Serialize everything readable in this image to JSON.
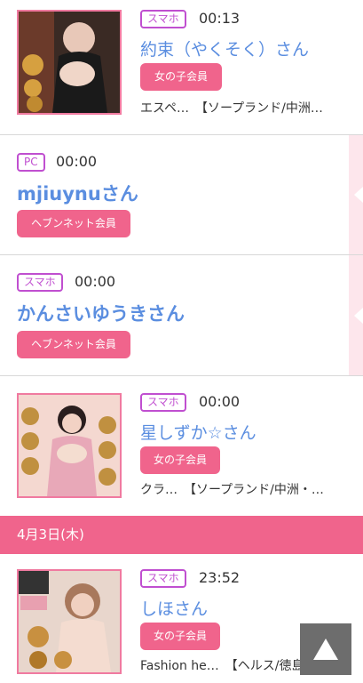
{
  "entries": [
    {
      "device": "スマホ",
      "time": "00:13",
      "name": "約束（やくそく）さん",
      "member_type": "女の子会員",
      "shop": "エスペ…　【ソープランド/中洲…"
    },
    {
      "device": "PC",
      "time": "00:00",
      "name": "mjiuynuさん",
      "member_type": "ヘブンネット会員"
    },
    {
      "device": "スマホ",
      "time": "00:00",
      "name": "かんさいゆうきさん",
      "member_type": "ヘブンネット会員"
    },
    {
      "device": "スマホ",
      "time": "00:00",
      "name": "星しずか☆さん",
      "member_type": "女の子会員",
      "shop": "クラ…　【ソープランド/中洲・…"
    },
    {
      "device": "スマホ",
      "time": "23:52",
      "name": "しほさん",
      "member_type": "女の子会員",
      "shop": "Fashion he…　【ヘルス/徳島…"
    }
  ],
  "date_header": "4月3日(木)",
  "icons": {
    "back_to_top": "arrow-up-icon"
  },
  "colors": {
    "accent_pink": "#f0648c",
    "badge_purple": "#c04fd0",
    "name_blue": "#5b8ee0"
  }
}
